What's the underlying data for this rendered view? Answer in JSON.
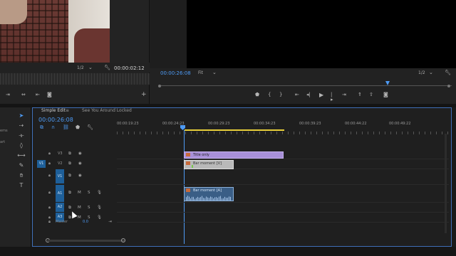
{
  "source_monitor": {
    "zoom": "1/2",
    "duration": "00:00:02:12"
  },
  "program_monitor": {
    "timecode": "00:00:26:08",
    "fit": "Fit",
    "zoom": "1/2"
  },
  "timeline": {
    "tabs": [
      {
        "label": "Simple Edit",
        "menu": "≡"
      },
      {
        "label": "See You Around Locked"
      }
    ],
    "timecode": "00:00:26:08",
    "ruler_ticks": [
      "00:00:19:23",
      "00:00:24:23",
      "00:00:29:23",
      "00:00:34:23",
      "00:00:39:23",
      "00:00:44:22",
      "00:00:49:22"
    ],
    "tracks": [
      {
        "name": "V3",
        "target": ""
      },
      {
        "name": "V2",
        "target": "V1"
      },
      {
        "name": "V1",
        "target": "V1"
      },
      {
        "name": "A1",
        "target": "A1"
      },
      {
        "name": "A2",
        "target": "A2"
      },
      {
        "name": "A3",
        "target": "A3"
      }
    ],
    "track_mute": "M",
    "track_solo": "S",
    "clips": {
      "title": "Title only",
      "video": "Bar moment [V]",
      "audio": "Bar moment [A]"
    },
    "master": {
      "label": "Master",
      "value": "0.0"
    }
  },
  "side_labels": [
    "ems",
    "art"
  ],
  "colors": {
    "accent": "#4e9bf5",
    "title_clip": "#a890d8",
    "video_clip": "#b9b9b9",
    "audio_clip": "#3a5e86",
    "work_area": "#e8cf3a",
    "track_target": "#1e5f99"
  }
}
